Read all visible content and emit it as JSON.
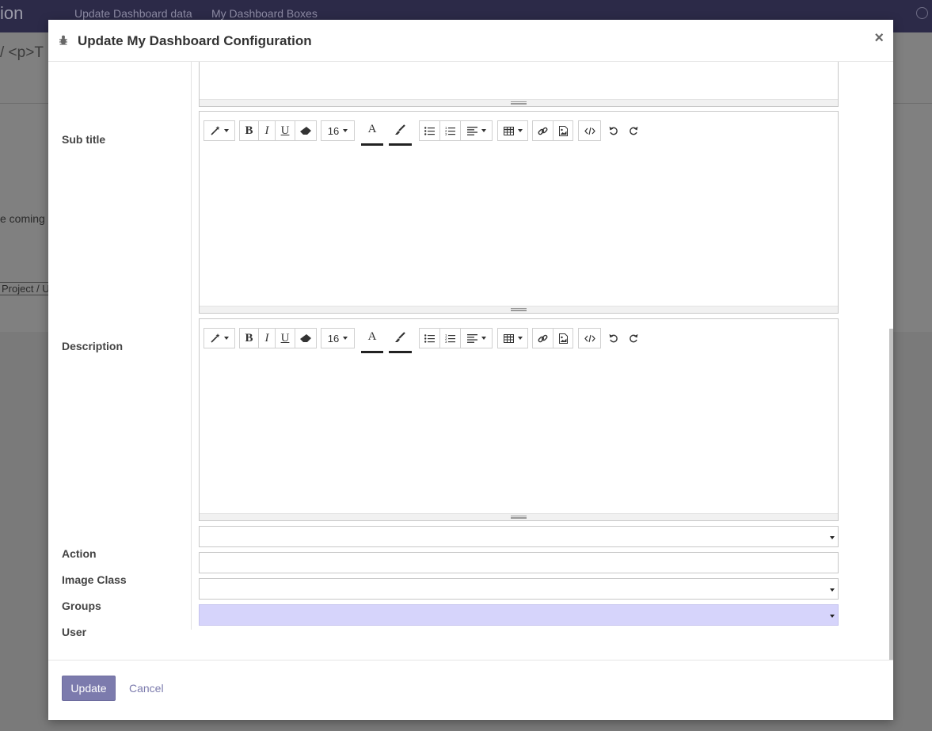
{
  "background": {
    "app_name": "ion",
    "menu": [
      "Update Dashboard data",
      "My Dashboard Boxes"
    ],
    "breadcrumb": "/ <p>T",
    "body_text": "e coming s",
    "link_text": "Project / Us"
  },
  "modal": {
    "title": "Update My Dashboard Configuration",
    "close": "×",
    "fields": {
      "sub_title": "Sub title",
      "description": "Description",
      "action": "Action",
      "image_class": "Image Class",
      "groups": "Groups",
      "user": "User"
    },
    "editor": {
      "font_size": "16",
      "icons": [
        "magic-wand-icon",
        "bold-icon",
        "italic-icon",
        "underline-icon",
        "eraser-icon",
        "font-size-dropdown",
        "font-color-icon",
        "highlight-color-icon",
        "unordered-list-icon",
        "ordered-list-icon",
        "align-icon",
        "table-icon",
        "link-icon",
        "image-icon",
        "code-view-icon",
        "undo-icon",
        "redo-icon"
      ]
    },
    "footer": {
      "update_label": "Update",
      "cancel_label": "Cancel"
    }
  },
  "colors": {
    "topbar": "#2c2a48",
    "primary": "#7c7bad",
    "user_field": "#d6d4fb"
  }
}
